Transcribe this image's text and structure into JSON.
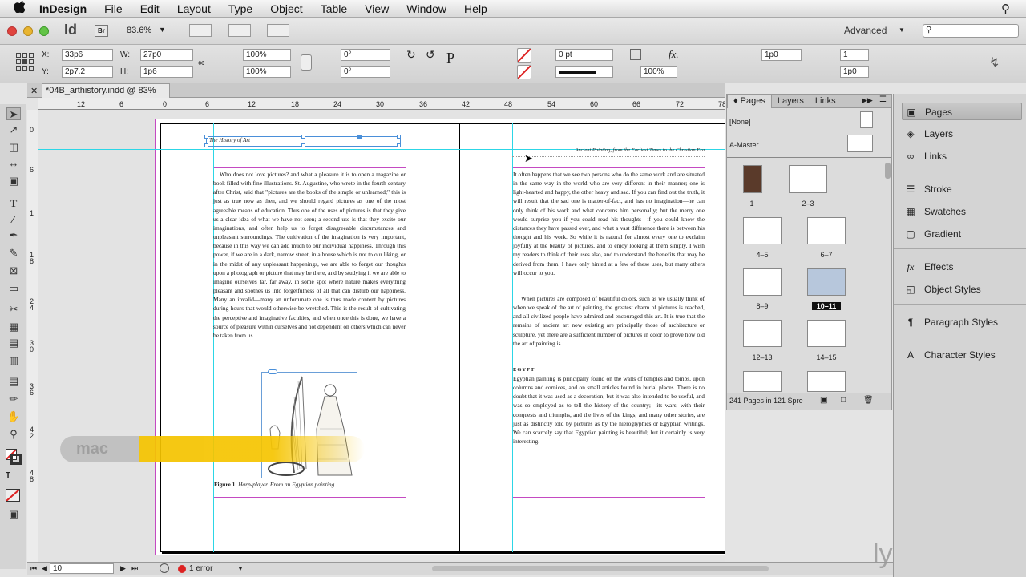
{
  "menu": {
    "apple": "",
    "app": "InDesign",
    "items": [
      "File",
      "Edit",
      "Layout",
      "Type",
      "Object",
      "Table",
      "View",
      "Window",
      "Help"
    ]
  },
  "appbar": {
    "logo": "Id",
    "bridge": "Br",
    "zoom": "83.6%",
    "workspace": "Advanced",
    "search_placeholder": ""
  },
  "control": {
    "x_label": "X:",
    "x_value": "33p6",
    "y_label": "Y:",
    "y_value": "2p7.2",
    "w_label": "W:",
    "w_value": "27p0",
    "h_label": "H:",
    "h_value": "1p6",
    "scale_x": "100%",
    "scale_y": "100%",
    "rotate": "0°",
    "shear": "0°",
    "stroke_weight": "0 pt",
    "opacity": "100%",
    "offset1": "1p0",
    "offset2": "1p0",
    "columns": "1",
    "gutter": "1p0"
  },
  "document_tab": {
    "title": "*04B_arthistory.indd @ 83%"
  },
  "ruler": {
    "labels": [
      "12",
      "6",
      "0",
      "6",
      "12",
      "18",
      "24",
      "30",
      "36",
      "42",
      "48",
      "54",
      "60",
      "66",
      "72",
      "78"
    ],
    "v_labels": [
      "0",
      "6",
      "1",
      "1",
      "8",
      "2",
      "4",
      "3",
      "0",
      "3",
      "6",
      "4",
      "2",
      "4",
      "8"
    ]
  },
  "left_page": {
    "running_head": "The History of Art",
    "body": "Who does not love pictures? and what a pleasure it is to open a magazine or book filled with fine illustrations. St. Augustine, who wrote in the fourth century after Christ, said that \"pictures are the books of the simple or unlearned;\" this is just as true now as then, and we should regard pictures as one of the most agreeable means of education. Thus one of the uses of pictures is that they give us a clear idea of what we have not seen; a second use is that they excite our imaginations, and often help us to forget disagreeable circumstances and unpleasant surroundings. The cultivation of the imagination is very important, because in this way we can add much to our individual happiness. Through this power, if we are in a dark, narrow street, in a house which is not to our liking, or in the midst of any unpleasant happenings, we are able to forget our thoughts upon a photograph or picture that may be there, and by studying it we are able to imagine ourselves far, far away, in some spot where nature makes everything pleasant and soothes us into forgetfulness of all that can disturb our happiness. Many an invalid—many an unfortunate one is thus made content by pictures during hours that would otherwise be wretched. This is the result of cultivating the perceptive and imaginative faculties, and when once this is done, we have a source of pleasure within ourselves and not dependent on others which can never be taken from us.",
    "caption_bold": "Figure 1.",
    "caption_italic": "Harp-player. From an Egyptian painting."
  },
  "right_page": {
    "running_head": "Ancient Painting, from the Earliest Times to the Christian Era",
    "body1": "It often happens that we see two persons who do the same work and are situated in the same way in the world who are very different in their manner; one is light-hearted and happy, the other heavy and sad. If you can find out the truth, it will result that the sad one is matter-of-fact, and has no imagination—he can only think of his work and what concerns him personally; but the merry one would surprise you if you could read his thoughts—if you could know the distances they have passed over, and what a vast difference there is between his thought and his work. So while it is natural for almost every one to exclaim joyfully at the beauty of pictures, and to enjoy looking at them simply, I wish my readers to think of their uses also, and to understand the benefits that may be derived from them. I have only hinted at a few of these uses, but many others will occur to you.",
    "body2": "When pictures are composed of beautiful colors, such as we usually think of when we speak of the art of painting, the greatest charm of pictures is reached, and all civilized people have admired and encouraged this art. It is true that the remains of ancient art now existing are principally those of architecture or sculpture, yet there are a sufficient number of pictures in color to prove how old the art of painting is.",
    "heading": "EGYPT",
    "body3": "Egyptian painting is principally found on the walls of temples and tombs, upon columns and cornices, and on small articles found in burial places. There is no doubt that it was used as a decoration; but it was also intended to be useful, and was so employed as to tell the history of the country;—its wars, with their conquests and triumphs, and the lives of the kings, and many other stories, are just as distinctly told by pictures as by the hieroglyphics or Egyptian writings. We can scarcely say that Egyptian painting is beautiful; but it certainly is very interesting."
  },
  "overlay": {
    "badge": "mac",
    "accent": "#f5c400"
  },
  "watermark": "lynda.com",
  "pages_panel": {
    "tabs": [
      "Pages",
      "Layers",
      "Links"
    ],
    "none_label": "[None]",
    "master_label": "A-Master",
    "thumb_labels": [
      "1",
      "2–3",
      "4–5",
      "6–7",
      "8–9",
      "10–11",
      "12–13",
      "14–15"
    ],
    "footer": "241 Pages in 121 Spre"
  },
  "dock": {
    "items": [
      "Pages",
      "Layers",
      "Links",
      "Stroke",
      "Swatches",
      "Gradient",
      "Effects",
      "Object Styles",
      "Paragraph Styles",
      "Character Styles"
    ],
    "icons": [
      "pages-icon",
      "layers-icon",
      "links-icon",
      "stroke-icon",
      "swatches-icon",
      "gradient-icon",
      "effects-icon",
      "object-styles-icon",
      "paragraph-styles-icon",
      "character-styles-icon"
    ]
  },
  "status": {
    "page": "10",
    "errors": "1 error"
  }
}
